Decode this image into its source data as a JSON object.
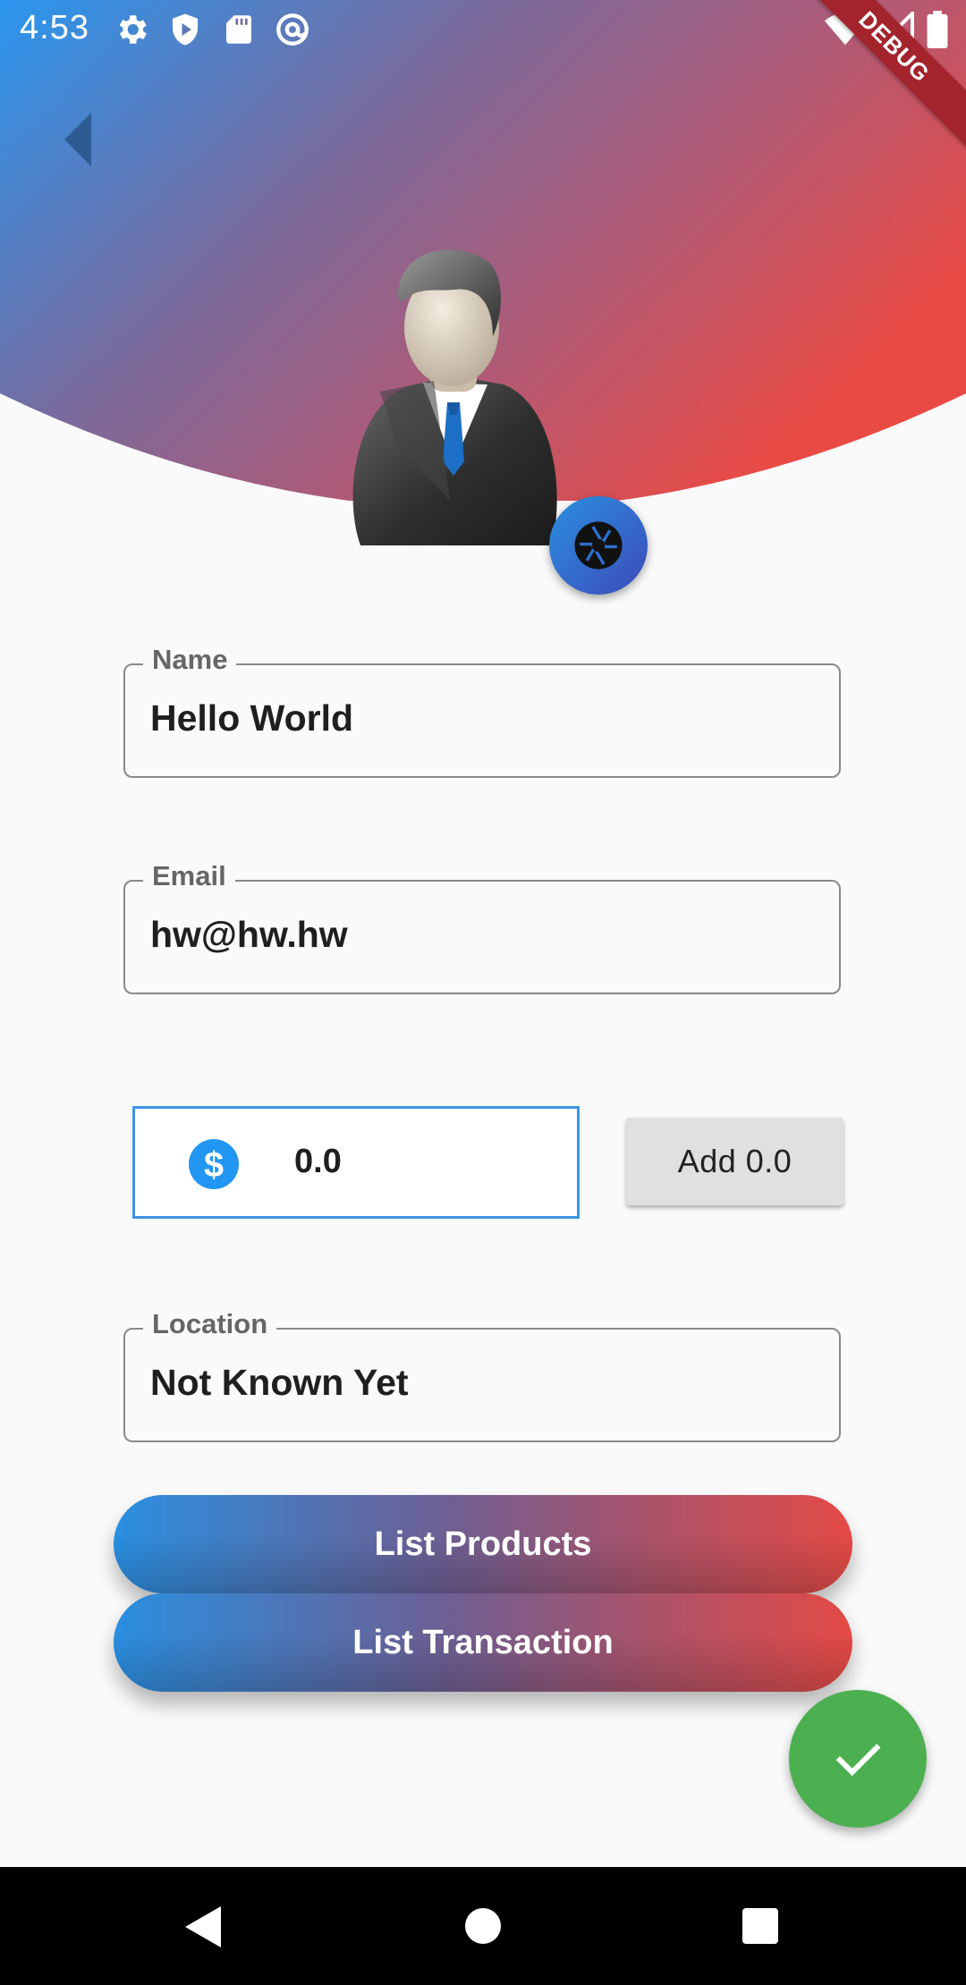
{
  "status_bar": {
    "time": "4:53",
    "icons": [
      "gear-icon",
      "shield-icon",
      "sd-card-icon",
      "at-sign-icon",
      "wifi-icon",
      "signal-icon",
      "battery-icon"
    ]
  },
  "debug_banner": "DEBUG",
  "form": {
    "name": {
      "label": "Name",
      "value": "Hello World"
    },
    "email": {
      "label": "Email",
      "value": "hw@hw.hw"
    },
    "amount": {
      "value": "0.0",
      "icon": "dollar-icon"
    },
    "add_button_label": "Add 0.0",
    "location": {
      "label": "Location",
      "value": "Not Known Yet"
    }
  },
  "buttons": {
    "list_products": "List Products",
    "list_transaction": "List Transaction"
  },
  "colors": {
    "gradient_start": "#2a8fe0",
    "gradient_end": "#e44a45",
    "fab": "#4caf50",
    "amount_border": "#3c96e3"
  }
}
